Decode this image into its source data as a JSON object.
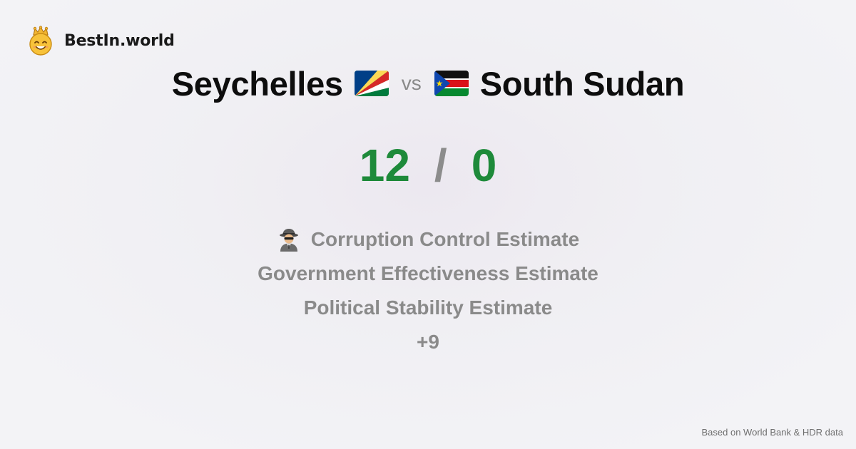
{
  "brand": {
    "name": "BestIn.world",
    "logo_icon": "crowned-smiley-icon"
  },
  "comparison": {
    "country_a": {
      "name": "Seychelles",
      "flag_icon": "seychelles-flag-icon"
    },
    "vs_label": "vs",
    "country_b": {
      "name": "South Sudan",
      "flag_icon": "south-sudan-flag-icon"
    }
  },
  "score": {
    "a": "12",
    "separator": "/",
    "b": "0",
    "color": "#1e8a3a"
  },
  "metrics": {
    "icon": "spy-detective-icon",
    "items": [
      "Corruption Control Estimate",
      "Government Effectiveness Estimate",
      "Political Stability Estimate"
    ],
    "more": "+9"
  },
  "footer": {
    "source_note": "Based on World Bank & HDR data"
  }
}
